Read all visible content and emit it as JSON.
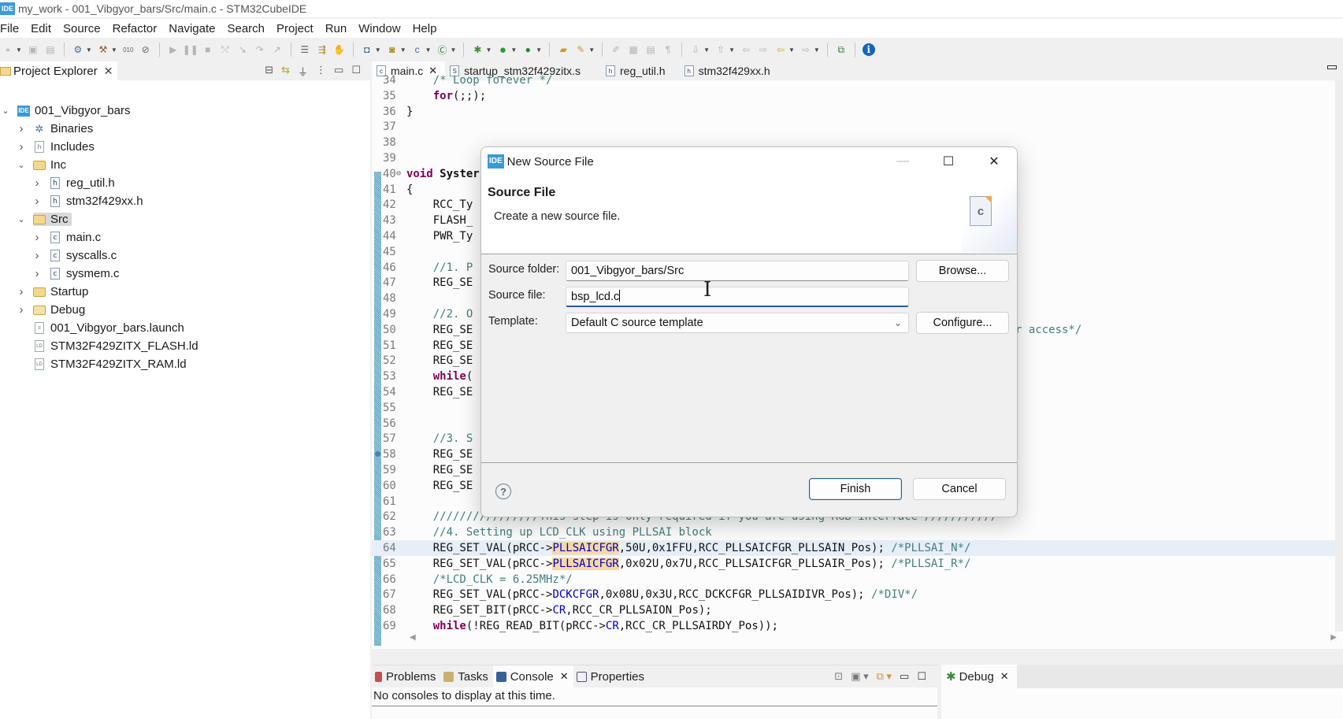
{
  "window": {
    "title": "my_work - 001_Vibgyor_bars/Src/main.c - STM32CubeIDE",
    "app_badge": "IDE"
  },
  "menu": [
    "File",
    "Edit",
    "Source",
    "Refactor",
    "Navigate",
    "Search",
    "Project",
    "Run",
    "Window",
    "Help"
  ],
  "toolbar": {
    "icons": [
      "new-icon",
      "save-icon",
      "save-all-icon",
      "build-config-icon",
      "build-hammer-icon",
      "binary-icon",
      "skip-breakpoints-icon",
      "resume-icon",
      "suspend-icon",
      "terminate-icon",
      "disconnect-icon",
      "step-into-icon",
      "step-over-icon",
      "step-return-icon",
      "drop-to-frame-icon",
      "use-step-filters-icon",
      "instruction-stepping-icon",
      "new-c-project-icon",
      "new-source-folder-icon",
      "new-c-file-icon",
      "new-class-icon",
      "debug-icon",
      "run-icon",
      "external-tools-icon",
      "open-element-icon",
      "search-icon",
      "toggle-mark-icon",
      "next-annotation-icon",
      "previous-annotation-icon",
      "back-icon",
      "forward-icon",
      "open-perspective-icon",
      "info-icon"
    ]
  },
  "explorer": {
    "title": "Project Explorer",
    "tree": [
      {
        "label": "001_Vibgyor_bars",
        "icon": "project-icon",
        "depth": 0,
        "expander": "expanded"
      },
      {
        "label": "Binaries",
        "icon": "binaries-icon",
        "depth": 1,
        "expander": "collapsed"
      },
      {
        "label": "Includes",
        "icon": "includes-icon",
        "depth": 1,
        "expander": "collapsed"
      },
      {
        "label": "Inc",
        "icon": "source-folder-icon",
        "depth": 1,
        "expander": "expanded"
      },
      {
        "label": "reg_util.h",
        "icon": "header-file-icon",
        "depth": 2,
        "expander": "collapsed"
      },
      {
        "label": "stm32f429xx.h",
        "icon": "header-file-icon",
        "depth": 2,
        "expander": "collapsed"
      },
      {
        "label": "Src",
        "icon": "source-folder-icon",
        "depth": 1,
        "expander": "expanded",
        "selected": true
      },
      {
        "label": "main.c",
        "icon": "c-file-icon",
        "depth": 2,
        "expander": "collapsed"
      },
      {
        "label": "syscalls.c",
        "icon": "c-file-icon",
        "depth": 2,
        "expander": "collapsed"
      },
      {
        "label": "sysmem.c",
        "icon": "c-file-icon",
        "depth": 2,
        "expander": "collapsed"
      },
      {
        "label": "Startup",
        "icon": "source-folder-icon",
        "depth": 1,
        "expander": "collapsed"
      },
      {
        "label": "Debug",
        "icon": "folder-icon",
        "depth": 1,
        "expander": "collapsed"
      },
      {
        "label": "001_Vibgyor_bars.launch",
        "icon": "launch-file-icon",
        "depth": 1,
        "expander": "none"
      },
      {
        "label": "STM32F429ZITX_FLASH.ld",
        "icon": "linker-file-icon",
        "depth": 1,
        "expander": "none"
      },
      {
        "label": "STM32F429ZITX_RAM.ld",
        "icon": "linker-file-icon",
        "depth": 1,
        "expander": "none"
      }
    ]
  },
  "editor": {
    "tabs": [
      {
        "label": "main.c",
        "icon": "c",
        "active": true,
        "closable": true
      },
      {
        "label": "startup_stm32f429zitx.s",
        "icon": "S",
        "active": false
      },
      {
        "label": "reg_util.h",
        "icon": "h",
        "active": false
      },
      {
        "label": "stm32f429xx.h",
        "icon": "h",
        "active": false
      }
    ],
    "lines": [
      {
        "n": "34",
        "segs": [
          [
            "cm",
            "    /* Loop forever */"
          ]
        ]
      },
      {
        "n": "35",
        "segs": [
          [
            "",
            "    "
          ],
          [
            "kw",
            "for"
          ],
          [
            "",
            "(;;);"
          ]
        ]
      },
      {
        "n": "36",
        "segs": [
          [
            "",
            "}"
          ]
        ]
      },
      {
        "n": "37",
        "segs": []
      },
      {
        "n": "38",
        "segs": []
      },
      {
        "n": "39",
        "segs": []
      },
      {
        "n": "40",
        "segs": [
          [
            "kw",
            "void"
          ],
          [
            "",
            " "
          ],
          [
            "b",
            "Syster"
          ]
        ],
        "fold": true
      },
      {
        "n": "41",
        "segs": [
          [
            "",
            "{"
          ]
        ]
      },
      {
        "n": "42",
        "segs": [
          [
            "",
            "    RCC_Ty"
          ]
        ]
      },
      {
        "n": "43",
        "segs": [
          [
            "",
            "    FLASH_"
          ]
        ]
      },
      {
        "n": "44",
        "segs": [
          [
            "",
            "    PWR_Ty"
          ]
        ]
      },
      {
        "n": "45",
        "segs": []
      },
      {
        "n": "46",
        "segs": [
          [
            "cm",
            "    //1. P"
          ]
        ]
      },
      {
        "n": "47",
        "segs": [
          [
            "",
            "    REG_SE"
          ]
        ]
      },
      {
        "n": "48",
        "segs": []
      },
      {
        "n": "49",
        "segs": [
          [
            "cm",
            "    //2. O"
          ]
        ]
      },
      {
        "n": "50",
        "segs": [
          [
            "",
            "    REG_SE"
          ],
          [
            "cmr",
            "r access*/"
          ]
        ]
      },
      {
        "n": "51",
        "segs": [
          [
            "",
            "    REG_SE"
          ]
        ]
      },
      {
        "n": "52",
        "segs": [
          [
            "",
            "    REG_SE"
          ]
        ]
      },
      {
        "n": "53",
        "segs": [
          [
            "",
            "    "
          ],
          [
            "kw",
            "while"
          ],
          [
            "",
            "("
          ]
        ]
      },
      {
        "n": "54",
        "segs": [
          [
            "",
            "    REG_SE"
          ]
        ]
      },
      {
        "n": "55",
        "segs": []
      },
      {
        "n": "56",
        "segs": []
      },
      {
        "n": "57",
        "segs": [
          [
            "cm",
            "    //3. S"
          ]
        ]
      },
      {
        "n": "58",
        "segs": [
          [
            "",
            "    REG_SE"
          ]
        ],
        "marker": true
      },
      {
        "n": "59",
        "segs": [
          [
            "",
            "    REG_SE"
          ]
        ]
      },
      {
        "n": "60",
        "segs": [
          [
            "",
            "    REG_SE"
          ]
        ]
      },
      {
        "n": "61",
        "segs": []
      },
      {
        "n": "62",
        "segs": [
          [
            "cm",
            "    ////////////////This step is only required if you are using RGB interface ///////////"
          ]
        ]
      },
      {
        "n": "63",
        "segs": [
          [
            "cm",
            "    //4. Setting up LCD_CLK using PLLSAI block"
          ]
        ]
      },
      {
        "n": "64",
        "segs": [
          [
            "",
            "    REG_SET_VAL(pRCC->"
          ],
          [
            "occ",
            "PLLSAICFGR"
          ],
          [
            "",
            ",50U,0x1FFU,RCC_PLLSAICFGR_PLLSAIN_Pos); "
          ],
          [
            "cm",
            "/*PLLSAI_N*/"
          ]
        ],
        "current": true
      },
      {
        "n": "65",
        "segs": [
          [
            "",
            "    REG_SET_VAL(pRCC->"
          ],
          [
            "occ",
            "PLLSAICFGR"
          ],
          [
            "",
            ",0x02U,0x7U,RCC_PLLSAICFGR_PLLSAIR_Pos); "
          ],
          [
            "cm",
            "/*PLLSAI_R*/"
          ]
        ]
      },
      {
        "n": "66",
        "segs": [
          [
            "cm",
            "    /*LCD_CLK = 6.25MHz*/"
          ]
        ]
      },
      {
        "n": "67",
        "segs": [
          [
            "",
            "    REG_SET_VAL(pRCC->"
          ],
          [
            "fld",
            "DCKCFGR"
          ],
          [
            "",
            ",0x08U,0x3U,RCC_DCKCFGR_PLLSAIDIVR_Pos); "
          ],
          [
            "cm",
            "/*DIV*/"
          ]
        ]
      },
      {
        "n": "68",
        "segs": [
          [
            "",
            "    REG_SET_BIT(pRCC->"
          ],
          [
            "fld",
            "CR"
          ],
          [
            "",
            ",RCC_CR_PLLSAION_Pos);"
          ]
        ]
      },
      {
        "n": "69",
        "segs": [
          [
            "",
            "    "
          ],
          [
            "kw",
            "while"
          ],
          [
            "",
            "(!REG_READ_BIT(pRCC->"
          ],
          [
            "fld",
            "CR"
          ],
          [
            "",
            ",RCC_CR_PLLSAIRDY_Pos));"
          ]
        ]
      }
    ]
  },
  "bottom": {
    "tabs": [
      {
        "label": "Problems",
        "icon": "problems-icon",
        "active": false
      },
      {
        "label": "Tasks",
        "icon": "tasks-icon",
        "active": false
      },
      {
        "label": "Console",
        "icon": "console-icon",
        "active": true,
        "closable": true
      },
      {
        "label": "Properties",
        "icon": "properties-icon",
        "active": false
      }
    ],
    "console_message": "No consoles to display at this time.",
    "debug_tab": "Debug"
  },
  "dialog": {
    "title": "New Source File",
    "heading": "Source File",
    "description": "Create a new source file.",
    "fields": {
      "source_folder_label": "Source folder:",
      "source_folder_value": "001_Vibgyor_bars/Src",
      "source_file_label": "Source file:",
      "source_file_value": "bsp_lcd.c",
      "template_label": "Template:",
      "template_value": "Default C source template"
    },
    "buttons": {
      "browse": "Browse...",
      "configure": "Configure...",
      "finish": "Finish",
      "cancel": "Cancel",
      "help": "?"
    },
    "window_controls": {
      "minimize": "—",
      "maximize": "☐",
      "close": "✕"
    }
  },
  "colors": {
    "keyword": "#7f0055",
    "comment": "#3f7f7f",
    "field": "#0000c0",
    "occurrence": "#f4d9a8",
    "current_line": "#e6eff8",
    "focus_underline": "#1f5d94"
  }
}
